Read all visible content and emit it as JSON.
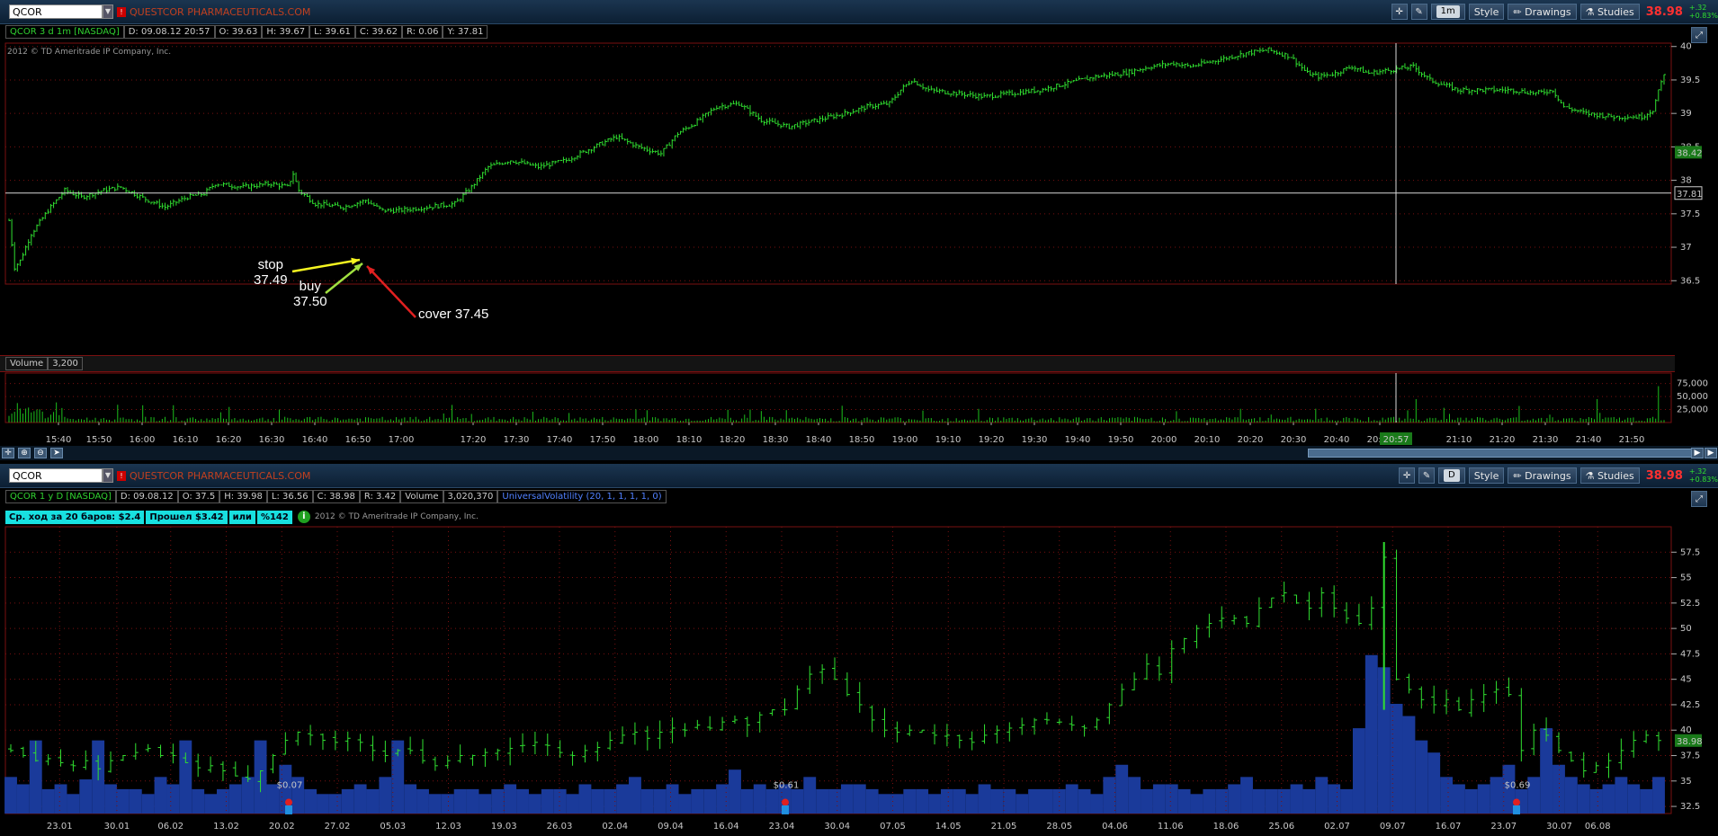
{
  "top": {
    "symbol": "QCOR",
    "company": "QUESTCOR PHARMACEUTICALS.COM",
    "timeframe": "1m",
    "style": "Style",
    "drawings": "Drawings",
    "studies": "Studies",
    "last": "38.98",
    "chg1": "+.32",
    "chg2": "+0.83%",
    "info": [
      "QCOR 3 d 1m [NASDAQ]",
      "D: 09.08.12 20:57",
      "O: 39.63",
      "H: 39.67",
      "L: 39.61",
      "C: 39.62",
      "R: 0.06",
      "Y: 37.81"
    ],
    "copyright": "2012 © TD Ameritrade IP Company, Inc.",
    "volume_label": "Volume",
    "volume_value": "3,200",
    "cursor_time": "20:57",
    "price_tag": "38.42",
    "cursor_price": "37.81",
    "annotations": {
      "stop": "stop",
      "stop_price": "37.49",
      "buy": "buy",
      "buy_price": "37.50",
      "cover": "cover 37.45"
    }
  },
  "bottom": {
    "symbol": "QCOR",
    "company": "QUESTCOR PHARMACEUTICALS.COM",
    "timeframe": "D",
    "style": "Style",
    "drawings": "Drawings",
    "studies": "Studies",
    "last": "38.98",
    "chg1": "+.32",
    "chg2": "+0.83%",
    "info": [
      "QCOR 1 y D [NASDAQ]",
      "D: 09.08.12",
      "O: 37.5",
      "H: 39.98",
      "L: 36.56",
      "C: 38.98",
      "R: 3.42",
      "Volume",
      "3,020,370",
      "UniversalVolatility (20, 1, 1, 1, 1, 0)"
    ],
    "stats": [
      "Ср. ход за 20 баров: $2.4",
      "Прошел $3.42",
      "или",
      "%142"
    ],
    "copyright": "2012 © TD Ameritrade IP Company, Inc.",
    "price_tag": "38.98",
    "dividends": [
      "$0.07",
      "$0.61",
      "$0.69"
    ]
  },
  "colors": {
    "price": "#30e030",
    "volume_intraday": "#1cc01c",
    "volume_daily": "#1a3a9a",
    "grid": "#7a1010",
    "crosshair": "#d8d8d8"
  },
  "chart_data": [
    {
      "type": "bar",
      "title": "QCOR 3 d 1m [NASDAQ]",
      "y_ticks": [
        36.5,
        37,
        37.5,
        38,
        38.5,
        39,
        39.5,
        40
      ],
      "ylim": [
        36.45,
        40.05
      ],
      "x_ticks": [
        "15:40",
        "15:50",
        "16:00",
        "16:10",
        "16:20",
        "16:30",
        "16:40",
        "16:50",
        "17:00",
        "17:20",
        "17:30",
        "17:40",
        "17:50",
        "18:00",
        "18:10",
        "18:20",
        "18:30",
        "18:40",
        "18:50",
        "19:00",
        "19:10",
        "19:20",
        "19:30",
        "19:40",
        "19:50",
        "20:00",
        "20:10",
        "20:20",
        "20:30",
        "20:40",
        "20:50",
        "21:10",
        "21:20",
        "21:30",
        "21:40",
        "21:50"
      ],
      "keypoints": [
        [
          0,
          37.4
        ],
        [
          2,
          36.7
        ],
        [
          4,
          36.8
        ],
        [
          8,
          37.2
        ],
        [
          14,
          37.55
        ],
        [
          20,
          37.85
        ],
        [
          26,
          37.75
        ],
        [
          34,
          37.85
        ],
        [
          40,
          37.9
        ],
        [
          50,
          37.7
        ],
        [
          56,
          37.6
        ],
        [
          64,
          37.75
        ],
        [
          70,
          37.8
        ],
        [
          74,
          37.95
        ],
        [
          84,
          37.9
        ],
        [
          94,
          37.95
        ],
        [
          100,
          37.9
        ],
        [
          102,
          38.1
        ],
        [
          104,
          37.85
        ],
        [
          110,
          37.65
        ],
        [
          120,
          37.6
        ],
        [
          128,
          37.7
        ],
        [
          134,
          37.55
        ],
        [
          140,
          37.55
        ],
        [
          150,
          37.6
        ],
        [
          160,
          37.65
        ],
        [
          166,
          37.9
        ],
        [
          172,
          38.2
        ],
        [
          180,
          38.3
        ],
        [
          190,
          38.2
        ],
        [
          200,
          38.3
        ],
        [
          210,
          38.5
        ],
        [
          218,
          38.65
        ],
        [
          226,
          38.5
        ],
        [
          234,
          38.4
        ],
        [
          240,
          38.7
        ],
        [
          246,
          38.85
        ],
        [
          254,
          39.1
        ],
        [
          262,
          39.15
        ],
        [
          270,
          38.9
        ],
        [
          280,
          38.8
        ],
        [
          290,
          38.9
        ],
        [
          300,
          39.0
        ],
        [
          308,
          39.1
        ],
        [
          316,
          39.15
        ],
        [
          320,
          39.35
        ],
        [
          324,
          39.5
        ],
        [
          330,
          39.35
        ],
        [
          340,
          39.3
        ],
        [
          350,
          39.25
        ],
        [
          360,
          39.3
        ],
        [
          370,
          39.35
        ],
        [
          380,
          39.45
        ],
        [
          390,
          39.55
        ],
        [
          400,
          39.6
        ],
        [
          410,
          39.7
        ],
        [
          418,
          39.75
        ],
        [
          424,
          39.7
        ],
        [
          434,
          39.8
        ],
        [
          444,
          39.9
        ],
        [
          452,
          39.95
        ],
        [
          460,
          39.85
        ],
        [
          466,
          39.6
        ],
        [
          470,
          39.55
        ],
        [
          476,
          39.6
        ],
        [
          482,
          39.7
        ],
        [
          488,
          39.6
        ],
        [
          496,
          39.65
        ],
        [
          504,
          39.7
        ],
        [
          510,
          39.5
        ],
        [
          520,
          39.35
        ],
        [
          530,
          39.35
        ],
        [
          540,
          39.35
        ],
        [
          548,
          39.3
        ],
        [
          554,
          39.35
        ],
        [
          558,
          39.1
        ],
        [
          566,
          39.0
        ],
        [
          576,
          38.95
        ],
        [
          586,
          38.95
        ],
        [
          590,
          39.05
        ],
        [
          594,
          39.6
        ]
      ],
      "n_bars": 595,
      "volume": {
        "y_ticks": [
          25000,
          50000,
          75000
        ],
        "ylim": [
          0,
          90000
        ]
      }
    },
    {
      "type": "bar",
      "title": "QCOR 1 y D [NASDAQ]",
      "y_ticks": [
        32.5,
        35,
        37.5,
        40,
        42.5,
        45,
        47.5,
        50,
        52.5,
        55,
        57.5
      ],
      "ylim": [
        31.8,
        60
      ],
      "x_ticks": [
        "23.01",
        "30.01",
        "06.02",
        "13.02",
        "20.02",
        "27.02",
        "05.03",
        "12.03",
        "19.03",
        "26.03",
        "02.04",
        "09.04",
        "16.04",
        "23.04",
        "30.04",
        "07.05",
        "14.05",
        "21.05",
        "28.05",
        "04.06",
        "11.06",
        "18.06",
        "25.06",
        "02.07",
        "09.07",
        "16.07",
        "23.07",
        "30.07",
        "06.08"
      ],
      "closes": [
        38,
        37.5,
        37,
        37.2,
        36.8,
        36.5,
        37,
        36.2,
        37,
        37.5,
        37.8,
        38.2,
        37.5,
        37.5,
        36.8,
        36.3,
        36.5,
        36,
        35.5,
        35.2,
        36,
        37.5,
        39,
        39.8,
        39.5,
        39,
        38.8,
        39.2,
        38.8,
        38,
        37.5,
        38,
        38,
        37,
        36.5,
        37,
        37.5,
        37.5,
        37.8,
        38,
        38.2,
        38.5,
        38.8,
        38.5,
        37.8,
        37.5,
        38,
        38.3,
        39,
        39.5,
        39.8,
        39.2,
        39.8,
        40.2,
        40,
        40.5,
        40.2,
        40.8,
        41,
        40.5,
        41.5,
        42,
        42,
        44,
        45.5,
        46,
        45,
        43.5,
        42.5,
        41,
        40,
        39.8,
        40,
        40,
        39.5,
        39.5,
        39,
        38.8,
        39.5,
        40,
        40.2,
        40.5,
        41,
        41,
        40.8,
        40.5,
        40.2,
        41,
        42.5,
        44,
        45,
        46.5,
        45.5,
        48,
        49,
        50,
        50.5,
        51,
        51,
        50.5,
        52,
        53,
        53.5,
        52.5,
        52,
        53.5,
        52,
        51,
        50.5,
        52,
        57,
        45,
        44,
        43,
        42.5,
        43,
        42,
        43,
        43.5,
        44,
        43.5,
        38,
        40,
        39.5,
        38,
        37,
        36,
        36.5,
        37,
        38,
        39,
        39.5,
        38.98
      ],
      "volume_rel": [
        0.15,
        0.12,
        0.3,
        0.1,
        0.12,
        0.08,
        0.14,
        0.3,
        0.12,
        0.1,
        0.1,
        0.08,
        0.15,
        0.12,
        0.3,
        0.1,
        0.08,
        0.1,
        0.12,
        0.15,
        0.3,
        0.12,
        0.2,
        0.15,
        0.1,
        0.08,
        0.08,
        0.1,
        0.12,
        0.1,
        0.15,
        0.3,
        0.12,
        0.1,
        0.08,
        0.08,
        0.1,
        0.1,
        0.08,
        0.1,
        0.12,
        0.1,
        0.08,
        0.1,
        0.1,
        0.08,
        0.12,
        0.1,
        0.1,
        0.12,
        0.15,
        0.1,
        0.1,
        0.12,
        0.08,
        0.1,
        0.1,
        0.12,
        0.18,
        0.1,
        0.12,
        0.1,
        0.12,
        0.1,
        0.15,
        0.1,
        0.1,
        0.12,
        0.12,
        0.1,
        0.08,
        0.08,
        0.1,
        0.1,
        0.08,
        0.1,
        0.1,
        0.08,
        0.12,
        0.1,
        0.1,
        0.08,
        0.1,
        0.1,
        0.1,
        0.12,
        0.1,
        0.08,
        0.15,
        0.2,
        0.15,
        0.1,
        0.12,
        0.12,
        0.1,
        0.08,
        0.1,
        0.1,
        0.12,
        0.15,
        0.1,
        0.1,
        0.1,
        0.12,
        0.1,
        0.15,
        0.12,
        0.1,
        0.35,
        0.65,
        0.6,
        0.45,
        0.4,
        0.3,
        0.25,
        0.15,
        0.12,
        0.1,
        0.12,
        0.15,
        0.2,
        0.1,
        0.15,
        0.35,
        0.2,
        0.15,
        0.12,
        0.1,
        0.12,
        0.15,
        0.12,
        0.1,
        0.15
      ]
    }
  ]
}
